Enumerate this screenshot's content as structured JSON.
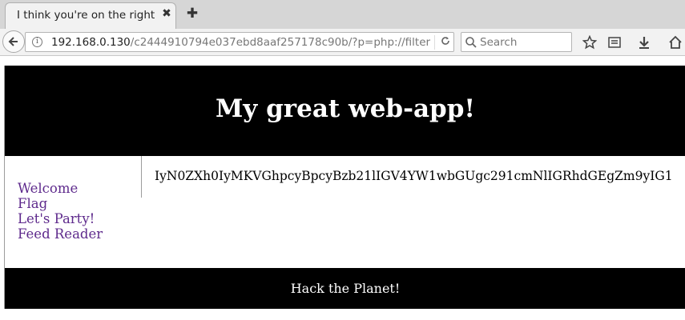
{
  "browser": {
    "tab_title": "I think you're on the right ...",
    "tab_close_glyph": "✖",
    "new_tab_glyph": "✚",
    "url_host": "192.168.0.130",
    "url_path": "/c2444910794e037ebd8aaf257178c90b/?p=php://filter",
    "search_placeholder": "Search",
    "icons": [
      "back-arrow-icon",
      "info-icon",
      "reload-icon",
      "search-icon",
      "bookmark-star-icon",
      "reading-list-icon",
      "download-icon",
      "home-icon"
    ]
  },
  "page": {
    "title": "My great web-app!",
    "menu": [
      "Welcome",
      "Flag",
      "Let's Party!",
      "Feed Reader"
    ],
    "content_text": "IyN0ZXh0IyMKVGhpcyBpcyBzb21lIGV4YW1wbGUgc291cmNlIGRhdGEgZm9yIG1",
    "footer": "Hack the Planet!"
  },
  "colors": {
    "header_bg": "#000000",
    "link": "#5e2a8c"
  }
}
